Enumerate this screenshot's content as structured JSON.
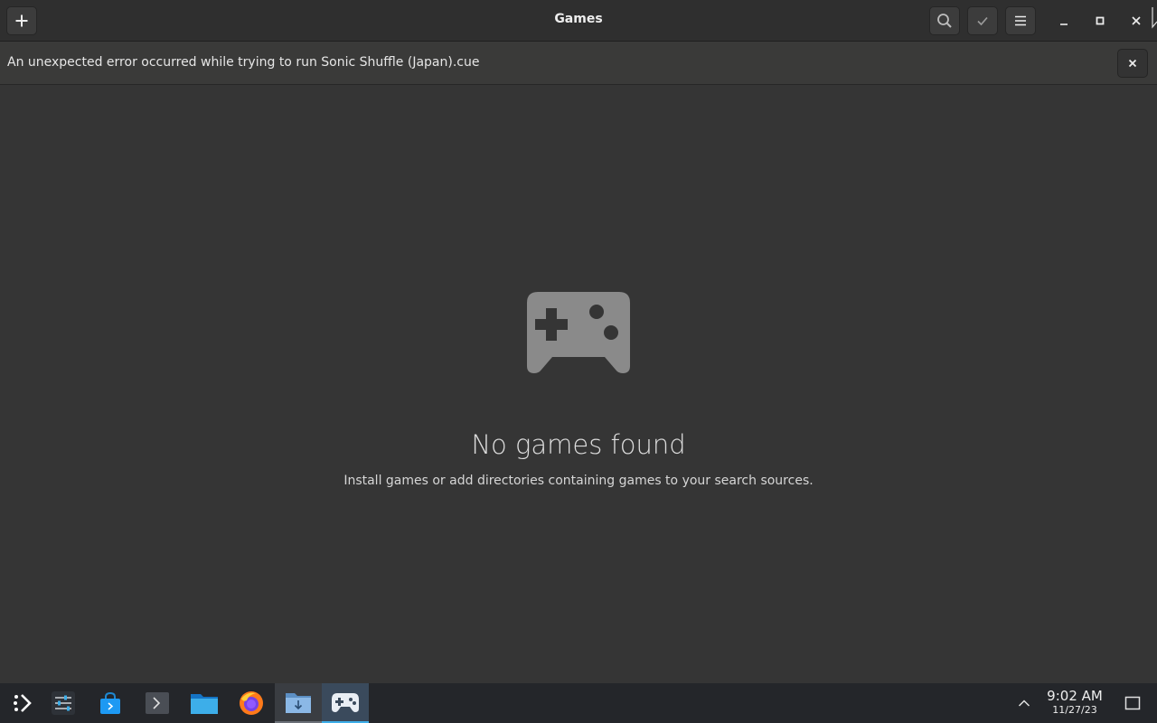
{
  "window": {
    "title": "Games",
    "icons": {
      "add": "plus-icon",
      "search": "search-icon",
      "selection": "checkmark-icon",
      "menu": "hamburger-menu-icon",
      "minimize": "minimize-icon",
      "maximize": "maximize-icon",
      "close": "close-icon"
    }
  },
  "infobar": {
    "message": "An unexpected error occurred while trying to run Sonic Shuffle (Japan).cue",
    "close_icon": "close-icon"
  },
  "empty_state": {
    "icon": "gamepad-icon",
    "title": "No games found",
    "description": "Install games or add directories containing games to your search sources."
  },
  "taskbar": {
    "items": [
      {
        "name": "application-launcher",
        "icon": "launcher-icon"
      },
      {
        "name": "system-settings",
        "icon": "settings-sliders-icon"
      },
      {
        "name": "discover",
        "icon": "store-bag-icon"
      },
      {
        "name": "konsole",
        "icon": "terminal-icon"
      },
      {
        "name": "dolphin",
        "icon": "folder-icon"
      },
      {
        "name": "firefox",
        "icon": "firefox-icon"
      },
      {
        "name": "downloads",
        "icon": "download-folder-icon",
        "state": "open"
      },
      {
        "name": "games",
        "icon": "gamepad-icon",
        "state": "active"
      }
    ],
    "clock": {
      "time": "9:02 AM",
      "date": "11/27/23"
    },
    "tray_icon": "chevron-up-icon",
    "show_desktop_icon": "show-desktop-icon"
  },
  "colors": {
    "background": "#353535",
    "headerbar": "#2f2f2f",
    "infobar": "#3a3a39",
    "taskbar": "#24262a",
    "accent": "#3daee9",
    "empty_icon": "#8a8a8a"
  }
}
